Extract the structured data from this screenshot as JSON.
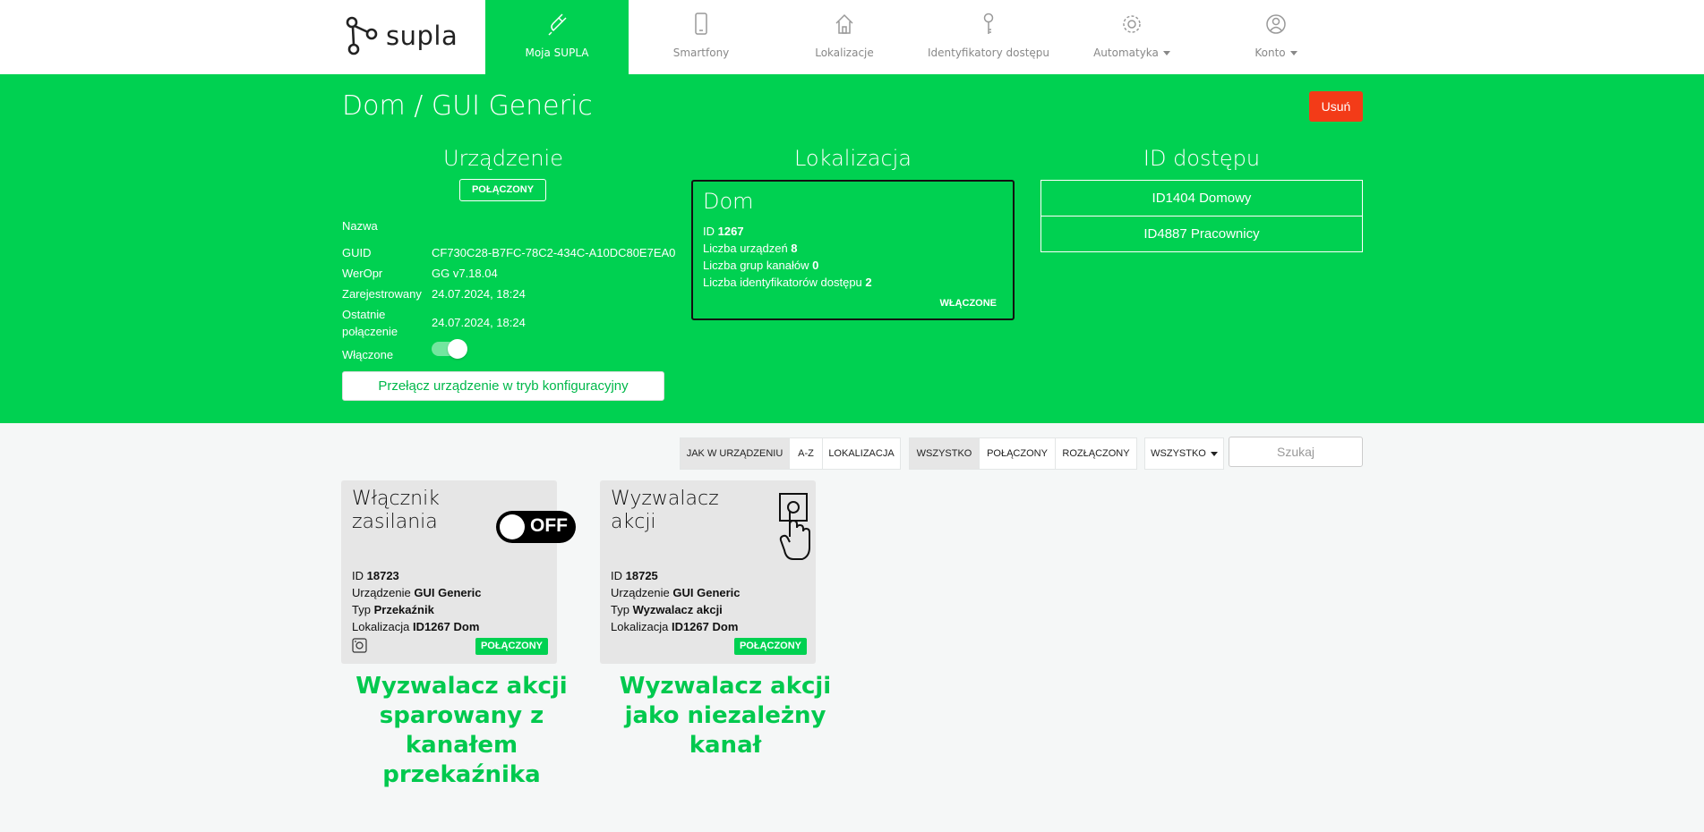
{
  "nav": {
    "logo_text": "supla",
    "items": [
      {
        "label": "Moja SUPLA",
        "icon": "plug-icon"
      },
      {
        "label": "Smartfony",
        "icon": "smartphone-icon"
      },
      {
        "label": "Lokalizacje",
        "icon": "home-icon"
      },
      {
        "label": "Identyfikatory dostępu",
        "icon": "key-icon"
      },
      {
        "label": "Automatyka",
        "icon": "gear-icon"
      },
      {
        "label": "Konto",
        "icon": "user-icon"
      }
    ],
    "active_color": "#00d151"
  },
  "header": {
    "title": "Dom / GUI Generic",
    "delete_label": "Usuń"
  },
  "device": {
    "heading": "Urządzenie",
    "status": "POŁĄCZONY",
    "name_label": "Nazwa",
    "guid_label": "GUID",
    "guid": "CF730C28-B7FC-78C2-434C-A10DC80E7EA0",
    "fw_label": "WerOpr",
    "fw": "GG v7.18.04",
    "registered_label": "Zarejestrowany",
    "registered": "24.07.2024, 18:24",
    "last_conn_label_1": "Ostatnie",
    "last_conn_label_2": "połączenie",
    "last_conn": "24.07.2024, 18:24",
    "enabled_label": "Włączone",
    "enabled": true,
    "config_button": "Przełącz urządzenie w tryb konfiguracyjny"
  },
  "location": {
    "heading": "Lokalizacja",
    "name": "Dom",
    "id_label": "ID",
    "id": "1267",
    "devices_label": "Liczba urządzeń",
    "devices": "8",
    "groups_label": "Liczba grup kanałów",
    "groups": "0",
    "aids_label": "Liczba identyfikatorów dostępu",
    "aids": "2",
    "status": "WŁĄCZONE"
  },
  "access_ids": {
    "heading": "ID dostępu",
    "items": [
      "ID1404 Domowy",
      "ID4887 Pracownicy"
    ]
  },
  "filters": {
    "sort": [
      "JAK W URZĄDZENIU",
      "A-Z",
      "LOKALIZACJA"
    ],
    "state": [
      "WSZYSTKO",
      "POŁĄCZONY",
      "ROZŁĄCZONY"
    ],
    "type_dropdown": "WSZYSTKO",
    "search_placeholder": "Szukaj"
  },
  "channels": [
    {
      "title_1": "Włącznik",
      "title_2": "zasilania",
      "icon": "power-switch-off-icon",
      "icon_text": "OFF",
      "id_label": "ID",
      "id": "18723",
      "device_label": "Urządzenie",
      "device": "GUI Generic",
      "type_label": "Typ",
      "type": "Przekaźnik",
      "location_label": "Lokalizacja",
      "location": "ID1267 Dom",
      "status": "POŁĄCZONY"
    },
    {
      "title_1": "Wyzwalacz",
      "title_2": "akcji",
      "icon": "action-trigger-icon",
      "id_label": "ID",
      "id": "18725",
      "device_label": "Urządzenie",
      "device": "GUI Generic",
      "type_label": "Typ",
      "type": "Wyzwalacz akcji",
      "location_label": "Lokalizacja",
      "location": "ID1267 Dom",
      "status": "POŁĄCZONY"
    }
  ],
  "captions": {
    "left": [
      "Wyzwalacz akcji",
      "sparowany z",
      "kanałem",
      "przekaźnika"
    ],
    "right": [
      "Wyzwalacz akcji",
      "jako niezależny",
      "kanał"
    ]
  }
}
